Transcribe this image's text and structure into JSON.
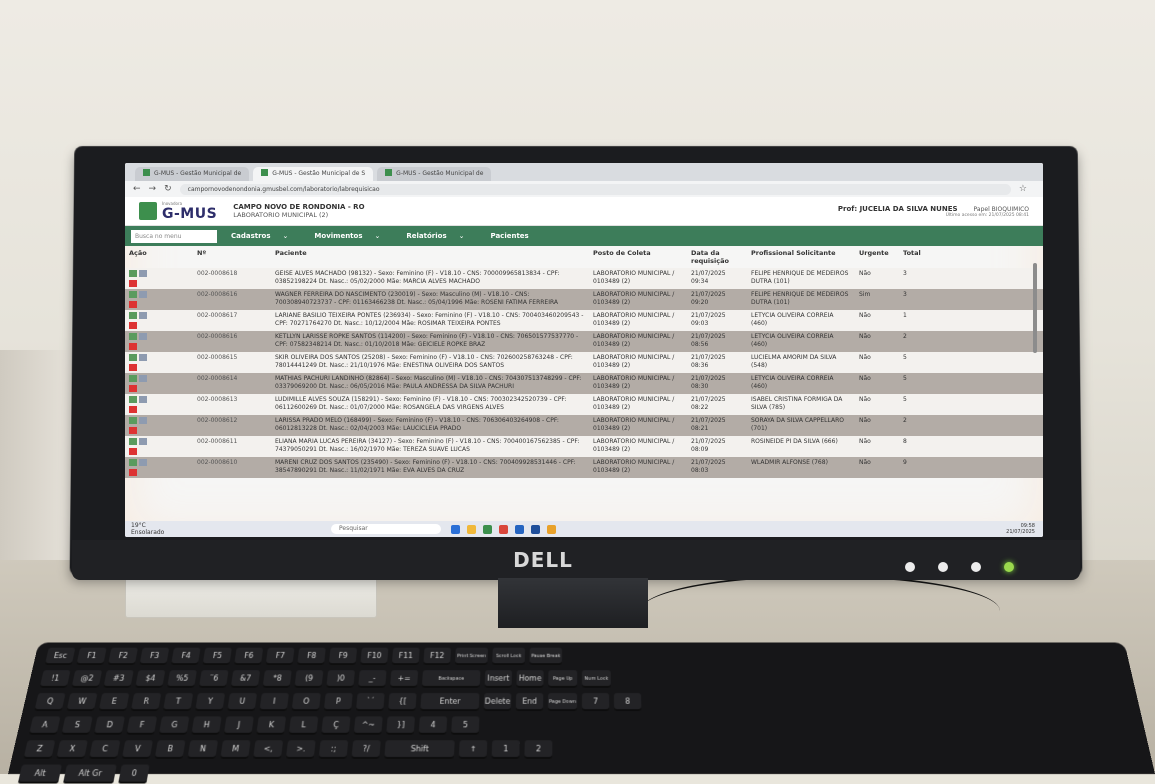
{
  "browser": {
    "tabs": [
      {
        "label": "G-MUS - Gestão Municipal de"
      },
      {
        "label": "G-MUS - Gestão Municipal de S"
      },
      {
        "label": "G-MUS - Gestão Municipal de"
      }
    ],
    "url": "campornovodenondonia.gmusbel.com/laboratorio/labrequisicao"
  },
  "app": {
    "logo": "G-MUS",
    "logo_sub": "Inovadora",
    "city": "CAMPO NOVO DE RONDONIA - RO",
    "unit": "LABORATORIO MUNICIPAL (2)",
    "user": "Prof: JUCELIA DA SILVA NUNES",
    "perfil": "Papel BIOQUIMICO",
    "access": "Último acesso em: 21/07/2025 08:41"
  },
  "menu": {
    "search_placeholder": "Busca no menu",
    "items": [
      "Cadastros",
      "Movimentos",
      "Relatórios",
      "Pacientes"
    ]
  },
  "table": {
    "headers": [
      "Ação",
      "Nº",
      "Paciente",
      "Posto de Coleta",
      "Data da requisição",
      "Profissional Solicitante",
      "Urgente",
      "Total"
    ],
    "rows": [
      {
        "nr": "002-0008618",
        "paciente": "GEISE ALVES MACHADO (98132) - Sexo: Feminino (F) - V18.10 - CNS: 700009965813834 - CPF: 03852198224 Dt. Nasc.: 05/02/2000 Mãe: MARCIA ALVES MACHADO",
        "posto": "LABORATORIO MUNICIPAL / 0103489 (2)",
        "data": "21/07/2025 09:34",
        "prof": "FELIPE HENRIQUE DE MEDEIROS DUTRA (101)",
        "urgente": "Não",
        "total": "3"
      },
      {
        "nr": "002-0008616",
        "paciente": "WAGNER FERREIRA DO NASCIMENTO (230019) - Sexo: Masculino (M) - V18.10 - CNS: 700308940723737 - CPF: 01163466238 Dt. Nasc.: 05/04/1996 Mãe: ROSENI FATIMA FERREIRA",
        "posto": "LABORATORIO MUNICIPAL / 0103489 (2)",
        "data": "21/07/2025 09:20",
        "prof": "FELIPE HENRIQUE DE MEDEIROS DUTRA (101)",
        "urgente": "Sim",
        "total": "3"
      },
      {
        "nr": "002-0008617",
        "paciente": "LARIANE BASILIO TEIXEIRA PONTES (236934) - Sexo: Feminino (F) - V18.10 - CNS: 700403460209543 - CPF: 70271764270 Dt. Nasc.: 10/12/2004 Mãe: ROSIMAR TEIXEIRA PONTES",
        "posto": "LABORATORIO MUNICIPAL / 0103489 (2)",
        "data": "21/07/2025 09:03",
        "prof": "LETYCIA OLIVEIRA CORREIA (460)",
        "urgente": "Não",
        "total": "1"
      },
      {
        "nr": "002-0008616",
        "paciente": "KETLLYN LARISSE ROPKE SANTOS (114200) - Sexo: Feminino (F) - V18.10 - CNS: 706501577537770 - CPF: 07582348214 Dt. Nasc.: 01/10/2018 Mãe: GEICIELE ROPKE BRAZ",
        "posto": "LABORATORIO MUNICIPAL / 0103489 (2)",
        "data": "21/07/2025 08:56",
        "prof": "LETYCIA OLIVEIRA CORREIA (460)",
        "urgente": "Não",
        "total": "2"
      },
      {
        "nr": "002-0008615",
        "paciente": "SKIR OLIVEIRA DOS SANTOS (25208) - Sexo: Feminino (F) - V18.10 - CNS: 702600258763248 - CPF: 78014441249 Dt. Nasc.: 21/10/1976 Mãe: ENESTINA OLIVEIRA DOS SANTOS",
        "posto": "LABORATORIO MUNICIPAL / 0103489 (2)",
        "data": "21/07/2025 08:36",
        "prof": "LUCIELMA AMORIM DA SILVA (548)",
        "urgente": "Não",
        "total": "5"
      },
      {
        "nr": "002-0008614",
        "paciente": "MATHIAS PACHURI LANDINHO (82864) - Sexo: Masculino (M) - V18.10 - CNS: 704307513748299 - CPF: 03379069200 Dt. Nasc.: 06/05/2016 Mãe: PAULA ANDRESSA DA SILVA PACHURI",
        "posto": "LABORATORIO MUNICIPAL / 0103489 (2)",
        "data": "21/07/2025 08:30",
        "prof": "LETYCIA OLIVEIRA CORREIA (460)",
        "urgente": "Não",
        "total": "5"
      },
      {
        "nr": "002-0008613",
        "paciente": "LUDIMILLE ALVES SOUZA (158291) - Sexo: Feminino (F) - V18.10 - CNS: 700302342520739 - CPF: 06112600269 Dt. Nasc.: 01/07/2000 Mãe: ROSANGELA DAS VIRGENS ALVES",
        "posto": "LABORATORIO MUNICIPAL / 0103489 (2)",
        "data": "21/07/2025 08:22",
        "prof": "ISABEL CRISTINA FORMIGA DA SILVA (785)",
        "urgente": "Não",
        "total": "5"
      },
      {
        "nr": "002-0008612",
        "paciente": "LARISSA PRADO MELO (168499) - Sexo: Feminino (F) - V18.10 - CNS: 706306403264908 - CPF: 06012813228 Dt. Nasc.: 02/04/2003 Mãe: LAUCICLEIA PRADO",
        "posto": "LABORATORIO MUNICIPAL / 0103489 (2)",
        "data": "21/07/2025 08:21",
        "prof": "SORAYA DA SILVA CAPPELLARO (701)",
        "urgente": "Não",
        "total": "2"
      },
      {
        "nr": "002-0008611",
        "paciente": "ELIANA MARIA LUCAS PEREIRA (34127) - Sexo: Feminino (F) - V18.10 - CNS: 700400167562385 - CPF: 74379050291 Dt. Nasc.: 16/02/1970 Mãe: TEREZA SUAVE LUCAS",
        "posto": "LABORATORIO MUNICIPAL / 0103489 (2)",
        "data": "21/07/2025 08:09",
        "prof": "ROSINEIDE PI DA SILVA (666)",
        "urgente": "Não",
        "total": "8"
      },
      {
        "nr": "002-0008610",
        "paciente": "MARENI CRUZ DOS SANTOS (235490) - Sexo: Feminino (F) - V18.10 - CNS: 700409928531446 - CPF: 38547890291 Dt. Nasc.: 11/02/1971 Mãe: EVA ALVES DA CRUZ",
        "posto": "LABORATORIO MUNICIPAL / 0103489 (2)",
        "data": "21/07/2025 08:03",
        "prof": "WLADMIR ALFONSE (768)",
        "urgente": "Não",
        "total": "9"
      }
    ]
  },
  "taskbar": {
    "weather": "19°C Ensolarado",
    "search": "Pesquisar",
    "time": "09:58",
    "date": "21/07/2025"
  },
  "monitor_brand": "DELL",
  "keyboard_rows": [
    [
      "Esc",
      "F1",
      "F2",
      "F3",
      "F4",
      "F5",
      "F6",
      "F7",
      "F8",
      "F9",
      "F10",
      "F11",
      "F12",
      "Print Screen",
      "Scroll Lock",
      "Pause Break"
    ],
    [
      "!1",
      "@2",
      "#3",
      "$4",
      "%5",
      "¨6",
      "&7",
      "*8",
      "(9",
      ")0",
      "_-",
      "+=",
      "Backspace",
      "Insert",
      "Home",
      "Page Up",
      "Num Lock"
    ],
    [
      "Q",
      "W",
      "E",
      "R",
      "T",
      "Y",
      "U",
      "I",
      "O",
      "P",
      "`´",
      "{[",
      "Enter",
      "Delete",
      "End",
      "Page Down",
      "7",
      "8"
    ],
    [
      "A",
      "S",
      "D",
      "F",
      "G",
      "H",
      "J",
      "K",
      "L",
      "Ç",
      "^~",
      "}]",
      "4",
      "5"
    ],
    [
      "Z",
      "X",
      "C",
      "V",
      "B",
      "N",
      "M",
      "<,",
      ">.",
      ":;",
      "?/",
      "Shift",
      "↑",
      "1",
      "2"
    ],
    [
      "Alt",
      "Alt Gr",
      "0"
    ]
  ]
}
